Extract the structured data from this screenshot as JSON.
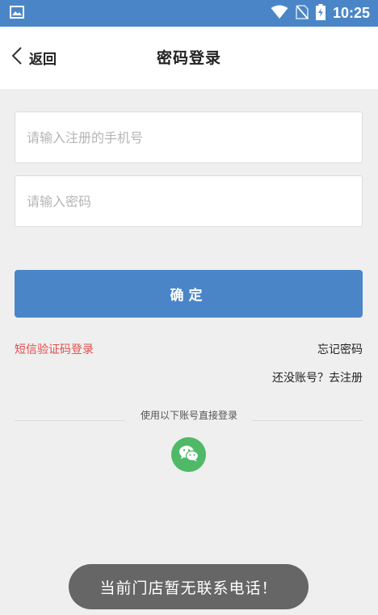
{
  "status_bar": {
    "time": "10:25",
    "icons": [
      "gallery-icon",
      "wifi-icon",
      "no-sim-icon",
      "battery-charging-icon"
    ],
    "bg_color": "#4a86c7"
  },
  "nav": {
    "back_label": "返回",
    "title": "密码登录"
  },
  "form": {
    "phone_placeholder": "请输入注册的手机号",
    "password_placeholder": "请输入密码",
    "confirm_label": "确定"
  },
  "links": {
    "sms_login": "短信验证码登录",
    "forgot_password": "忘记密码",
    "register": "还没账号？去注册"
  },
  "third_party": {
    "label": "使用以下账号直接登录",
    "icon": "wechat-icon",
    "color": "#4fb968"
  },
  "toast": {
    "message": "当前门店暂无联系电话！"
  },
  "colors": {
    "accent": "#4a86c7",
    "link_red": "#e24e4e",
    "background": "#efefef"
  }
}
